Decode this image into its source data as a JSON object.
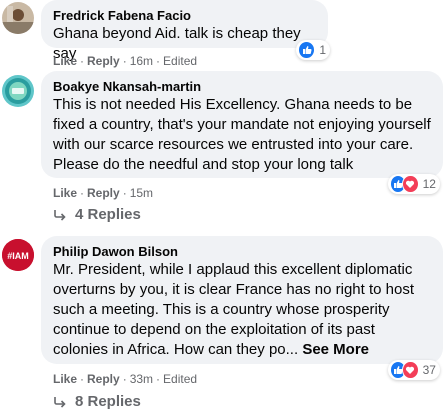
{
  "comments": [
    {
      "author": "Fredrick Fabena Facio",
      "text": "Ghana beyond Aid. talk is cheap they say",
      "actions": {
        "like": "Like",
        "reply": "Reply",
        "time": "16m",
        "edited": "Edited"
      },
      "reaction_count": "1"
    },
    {
      "author": "Boakye Nkansah-martin",
      "text": "This is not needed His Excellency. Ghana needs to be fixed a country, that's your mandate not enjoying yourself with our scarce resources we entrusted into your care. Please do the needful and stop your long talk",
      "actions": {
        "like": "Like",
        "reply": "Reply",
        "time": "15m"
      },
      "reaction_count": "12",
      "replies": "4 Replies"
    },
    {
      "author": "Philip Dawon Bilson",
      "avatar_text": "#IAM",
      "text": "Mr. President, while I applaud this excellent diplomatic overturns by you, it is clear France has no right to host such a meeting. This is a country whose prosperity continue to depend on the exploitation of its past colonies in Africa. How can they po...",
      "see_more": "See More",
      "actions": {
        "like": "Like",
        "reply": "Reply",
        "time": "33m",
        "edited": "Edited"
      },
      "reaction_count": "37",
      "replies": "8 Replies"
    }
  ],
  "colors": {
    "bubble": "#f0f2f5",
    "meta": "#65676b",
    "like_blue": "#1877f2",
    "love_red": "#f33e58"
  },
  "icons": [
    "like-reaction-icon",
    "love-reaction-icon",
    "reply-arrow-icon"
  ]
}
